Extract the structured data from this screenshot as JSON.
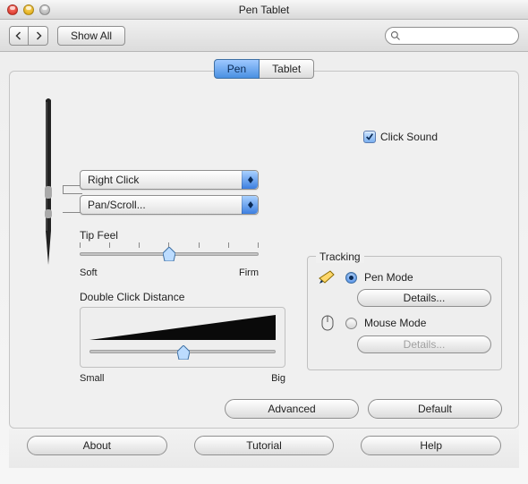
{
  "window": {
    "title": "Pen Tablet"
  },
  "toolbar": {
    "show_all": "Show All",
    "search_placeholder": ""
  },
  "tabs": {
    "pen": "Pen",
    "tablet": "Tablet",
    "active": "pen"
  },
  "click_sound_label": "Click Sound",
  "click_sound_checked": true,
  "pen_buttons": {
    "upper": "Right Click",
    "lower": "Pan/Scroll..."
  },
  "tip_feel": {
    "label": "Tip Feel",
    "min": "Soft",
    "max": "Firm",
    "value": 0.5
  },
  "double_click": {
    "label": "Double Click Distance",
    "min": "Small",
    "max": "Big",
    "value": 0.5
  },
  "tracking": {
    "title": "Tracking",
    "pen_mode": "Pen Mode",
    "mouse_mode": "Mouse Mode",
    "details": "Details...",
    "selected": "pen"
  },
  "buttons": {
    "advanced": "Advanced",
    "default": "Default",
    "about": "About",
    "tutorial": "Tutorial",
    "help": "Help"
  }
}
